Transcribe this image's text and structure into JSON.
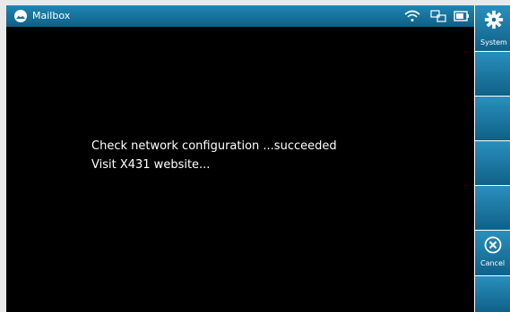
{
  "status_bar": {
    "title": "Mailbox",
    "icons": [
      "mailbox-icon",
      "wifi-icon",
      "network-icon",
      "battery-icon"
    ]
  },
  "main": {
    "lines": [
      "Check network configuration ...succeeded",
      "Visit X431 website..."
    ]
  },
  "sidebar": {
    "system_label": "System",
    "cancel_label": "Cancel",
    "icons": [
      "gear-icon",
      "cancel-icon"
    ]
  },
  "colors": {
    "accent": "#1a78a6",
    "background": "#000000",
    "text": "#ffffff"
  }
}
